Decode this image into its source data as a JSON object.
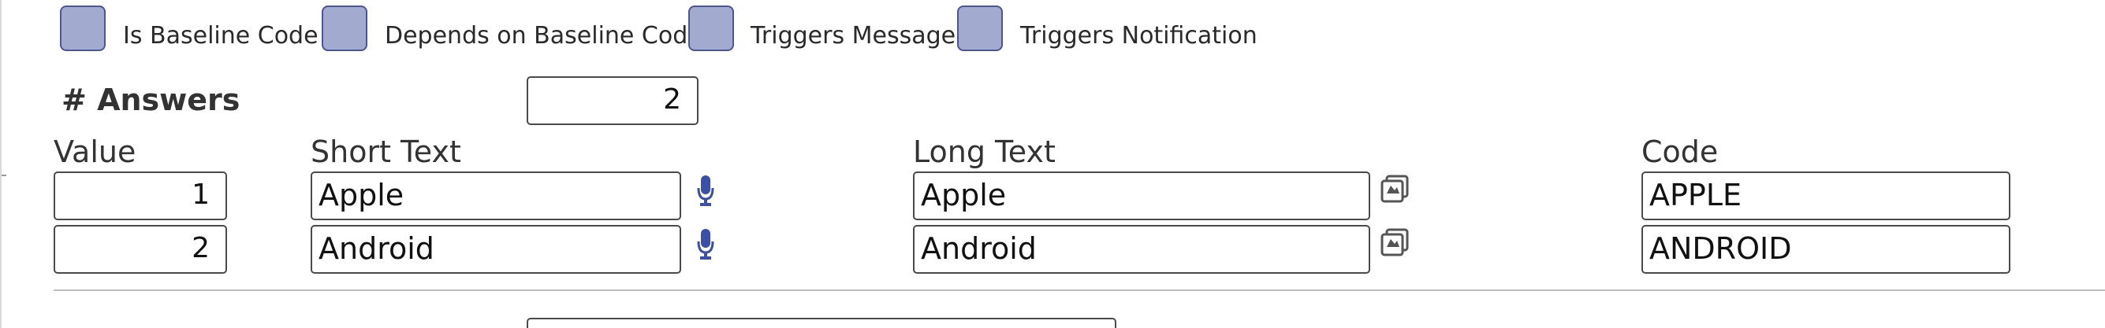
{
  "flags": [
    {
      "label": "Is Baseline Code"
    },
    {
      "label": "Depends on Baseline Code"
    },
    {
      "label": "Triggers Message"
    },
    {
      "label": "Triggers Notification"
    }
  ],
  "answers": {
    "label": "# Answers",
    "count": "2"
  },
  "columns": {
    "value": "Value",
    "short_text": "Short Text",
    "long_text": "Long Text",
    "code": "Code"
  },
  "rows": [
    {
      "value": "1",
      "short_text": "Apple",
      "long_text": "Apple",
      "code": "APPLE"
    },
    {
      "value": "2",
      "short_text": "Android",
      "long_text": "Android",
      "code": "ANDROID"
    }
  ],
  "icons": {
    "audio": "microphone-icon",
    "image": "image-gallery-icon"
  },
  "colors": {
    "checkbox_fill": "#a3aad0",
    "checkbox_border": "#4b5699",
    "mic_blue": "#3c4fa8",
    "image_icon": "#555555"
  }
}
